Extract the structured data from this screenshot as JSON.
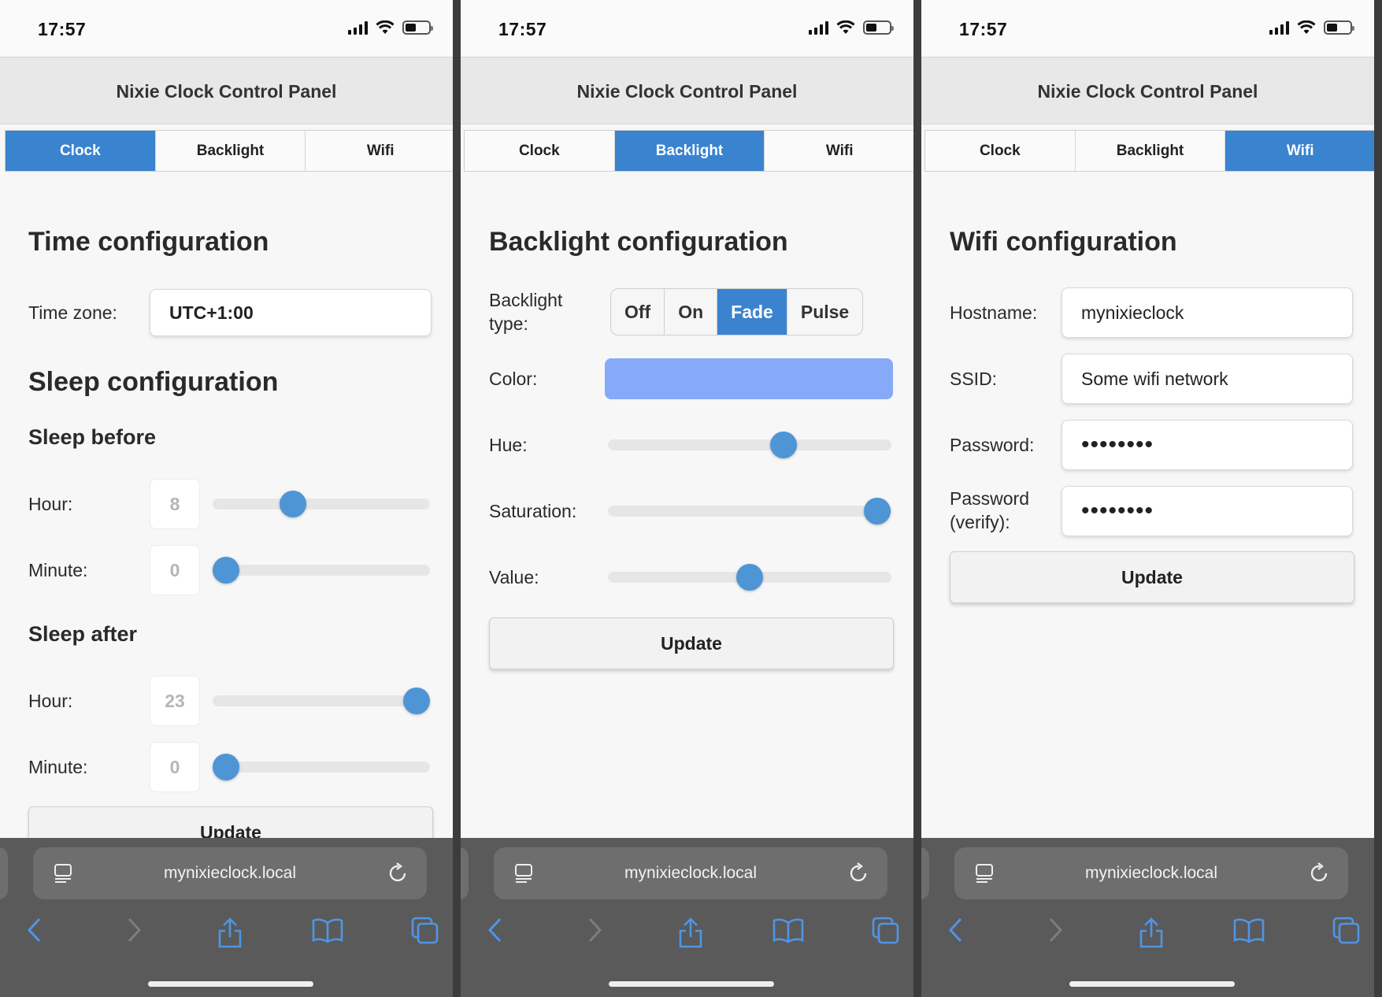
{
  "status": {
    "time": "17:57"
  },
  "app": {
    "title": "Nixie Clock Control Panel"
  },
  "tabs": [
    "Clock",
    "Backlight",
    "Wifi"
  ],
  "colors": {
    "accent": "#3a83cf",
    "slider_knob": "#4e95d6",
    "backlight_color": "#86aaf7"
  },
  "clock": {
    "time_heading": "Time configuration",
    "timezone_label": "Time zone:",
    "timezone_value": "UTC+1:00",
    "sleep_heading": "Sleep configuration",
    "sleep_before": {
      "heading": "Sleep before",
      "hour_label": "Hour:",
      "hour_value": "8",
      "minute_label": "Minute:",
      "minute_value": "0"
    },
    "sleep_after": {
      "heading": "Sleep after",
      "hour_label": "Hour:",
      "hour_value": "23",
      "minute_label": "Minute:",
      "minute_value": "0"
    },
    "update_label": "Update"
  },
  "backlight": {
    "heading": "Backlight configuration",
    "type_label_line1": "Backlight",
    "type_label_line2": "type:",
    "types": [
      "Off",
      "On",
      "Fade",
      "Pulse"
    ],
    "selected_type": "Fade",
    "color_label": "Color:",
    "hue_label": "Hue:",
    "hue_level": 0.62,
    "saturation_label": "Saturation:",
    "saturation_level": 0.95,
    "value_label": "Value:",
    "value_level": 0.5,
    "update_label": "Update"
  },
  "wifi": {
    "heading": "Wifi configuration",
    "hostname_label": "Hostname:",
    "hostname_value": "mynixieclock",
    "ssid_label": "SSID:",
    "ssid_value": "Some wifi network",
    "password_label": "Password:",
    "password_value": "••••••••",
    "password_verify_line1": "Password",
    "password_verify_line2": "(verify):",
    "password_verify_value": "••••••••",
    "update_label": "Update"
  },
  "browser": {
    "url": "mynixieclock.local"
  }
}
